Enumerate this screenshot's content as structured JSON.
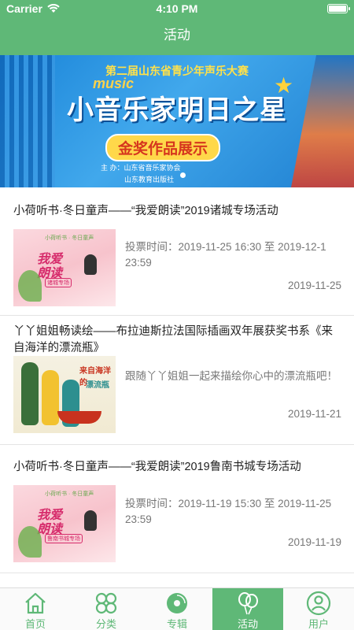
{
  "status_bar": {
    "carrier": "Carrier",
    "time": "4:10 PM"
  },
  "nav": {
    "title": "活动"
  },
  "banner": {
    "top_line": "第二届山东省青少年声乐大赛",
    "music_word": "music",
    "main_title": "小音乐家明日之星",
    "pill": "金奖作品展示",
    "host_line1": "主 办：山东省音乐家协会",
    "host_line2": "山东教育出版社"
  },
  "activities": [
    {
      "title": "小荷听书·冬日童声——“我爱朗读”2019诸城专场活动",
      "desc": "投票时间：2019-11-25 16:30 至 2019-12-1 23:59",
      "date": "2019-11-25",
      "thumb": {
        "small": "小荷听书 · 冬日童声",
        "line1": "我爱",
        "line2": "朗读",
        "tag": "诸城专场"
      }
    },
    {
      "title": "丫丫姐姐畅读绘——布拉迪斯拉法国际插画双年展获奖书系《来自海洋的漂流瓶》",
      "desc": "跟随丫丫姐姐一起来描绘你心中的漂流瓶吧！",
      "date": "2019-11-21",
      "thumb": {
        "line1": "来自海洋的",
        "line2": "漂流瓶"
      }
    },
    {
      "title": "小荷听书·冬日童声——“我爱朗读”2019鲁南书城专场活动",
      "desc": "投票时间：2019-11-19 15:30 至 2019-11-25 23:59",
      "date": "2019-11-19",
      "thumb": {
        "small": "小荷听书 · 冬日童声",
        "line1": "我爱",
        "line2": "朗读",
        "tag": "鲁南书城专场"
      }
    }
  ],
  "tabs": [
    {
      "label": "首页",
      "icon": "home-icon"
    },
    {
      "label": "分类",
      "icon": "category-icon"
    },
    {
      "label": "专辑",
      "icon": "album-icon"
    },
    {
      "label": "活动",
      "icon": "activity-icon",
      "active": true
    },
    {
      "label": "用户",
      "icon": "user-icon"
    }
  ],
  "colors": {
    "primary": "#5fb877",
    "banner_blue": "#1f7fd0",
    "accent_yellow": "#ffd84a"
  }
}
